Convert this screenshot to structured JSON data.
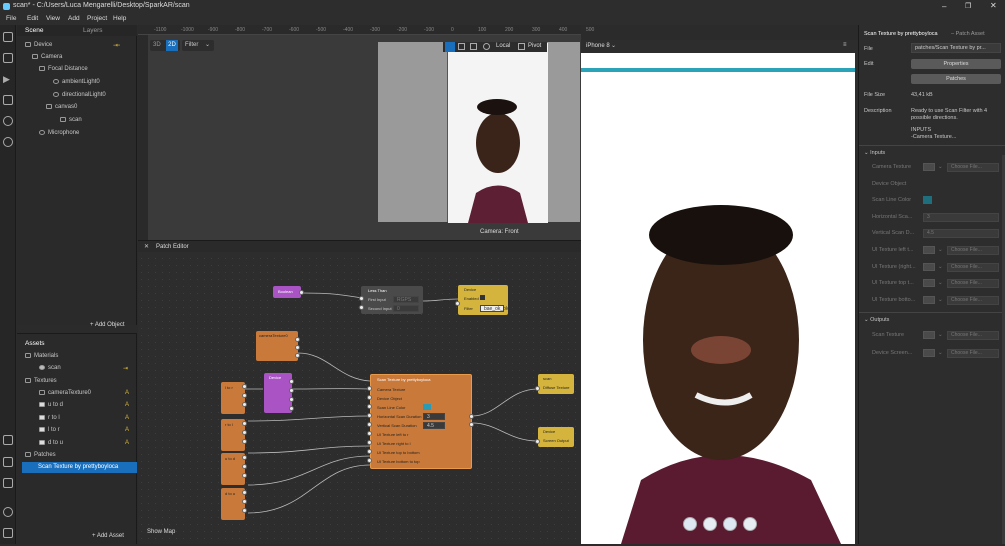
{
  "window": {
    "title": "scan* - C:/Users/Luca Mengarelli/Desktop/SparkAR/scan"
  },
  "menu": [
    "File",
    "Edit",
    "View",
    "Add",
    "Project",
    "Help"
  ],
  "scene": {
    "tabs": [
      "Scene",
      "Layers"
    ],
    "tree": [
      "Device",
      "Camera",
      "Focal Distance",
      "ambientLight0",
      "directionalLight0",
      "canvas0",
      "scan",
      "Microphone"
    ],
    "add_object": "+ Add Object"
  },
  "assets": {
    "title": "Assets",
    "materials_label": "Materials",
    "material": "scan",
    "textures_label": "Textures",
    "textures": [
      "cameraTexture0",
      "u to d",
      "r to l",
      "l to r",
      "d to u"
    ],
    "patches_label": "Patches",
    "patch": "Scan Texture by prettyboyloca",
    "add_asset": "+ Add Asset"
  },
  "viewport": {
    "mode3d": "3D",
    "mode2d": "2D",
    "filter": "Filter",
    "local": "Local",
    "pivot": "Pivot",
    "camera_label": "Camera: Front",
    "ruler": [
      "-1100",
      "-1000",
      "-900",
      "-800",
      "-700",
      "-600",
      "-500",
      "-400",
      "-300",
      "-200",
      "-100",
      "0",
      "100",
      "200",
      "300",
      "400",
      "500"
    ]
  },
  "patch_editor": {
    "title": "Patch Editor",
    "show_map": "Show Map",
    "less_than": {
      "title": "Less Than",
      "first": "First Input",
      "first_val": "RGPS",
      "second": "Second Input",
      "second_val": "0"
    },
    "device_top": {
      "title": "Device",
      "enabled": "Enabled",
      "filter": "Filter",
      "filter_val": "bae_ok_ok"
    },
    "scan_node": {
      "title": "Scan Texture by prettyboyloca",
      "inputs": [
        "Camera Texture",
        "Device Object",
        "Scan Line Color",
        "Horizontal Scan Duration",
        "Vertical Scan Duration",
        "UI Texture left to r",
        "UI Texture right to l",
        "UI Texture top to bottom",
        "UI Texture bottom to top"
      ],
      "h_val": "3",
      "v_val": "4.5"
    },
    "out_scan": {
      "title": "scan",
      "port": "Diffuse Texture"
    },
    "out_device": {
      "title": "Device",
      "port": "Screen Output"
    },
    "boolean_label": "Boolean",
    "camera_texture_label": "cameraTexture0",
    "device_label": "Device"
  },
  "preview": {
    "device": "iPhone 8"
  },
  "inspector": {
    "title": "Scan Texture by prettyboyloca",
    "subtitle": "– Patch Asset",
    "file_label": "File",
    "file_value": "patches/Scan Texture by pr...",
    "edit_label": "Edit",
    "properties_btn": "Properties",
    "patches_btn": "Patches",
    "size_label": "File Size",
    "size_value": "43,41 kB",
    "desc_label": "Description",
    "desc_value": "Ready to use Scan Filter with 4 possible directions.",
    "desc_inputs": "INPUTS",
    "desc_cam": "-Camera Texture...",
    "inputs_label": "Inputs",
    "inputs": [
      {
        "label": "Camera Texture",
        "kind": "file"
      },
      {
        "label": "Device Object",
        "kind": "none"
      },
      {
        "label": "Scan Line Color",
        "kind": "color"
      },
      {
        "label": "Horizontal Sca...",
        "kind": "num",
        "value": "3"
      },
      {
        "label": "Vertical Scan D...",
        "kind": "num",
        "value": "4.5"
      },
      {
        "label": "UI Texture left t...",
        "kind": "file"
      },
      {
        "label": "UI Texture (right...",
        "kind": "file"
      },
      {
        "label": "UI Texture top t...",
        "kind": "file"
      },
      {
        "label": "UI Texture botto...",
        "kind": "file"
      }
    ],
    "choose": "Choose File...",
    "outputs_label": "Outputs",
    "outputs": [
      {
        "label": "Scan Texture"
      },
      {
        "label": "Device Screen..."
      }
    ]
  }
}
